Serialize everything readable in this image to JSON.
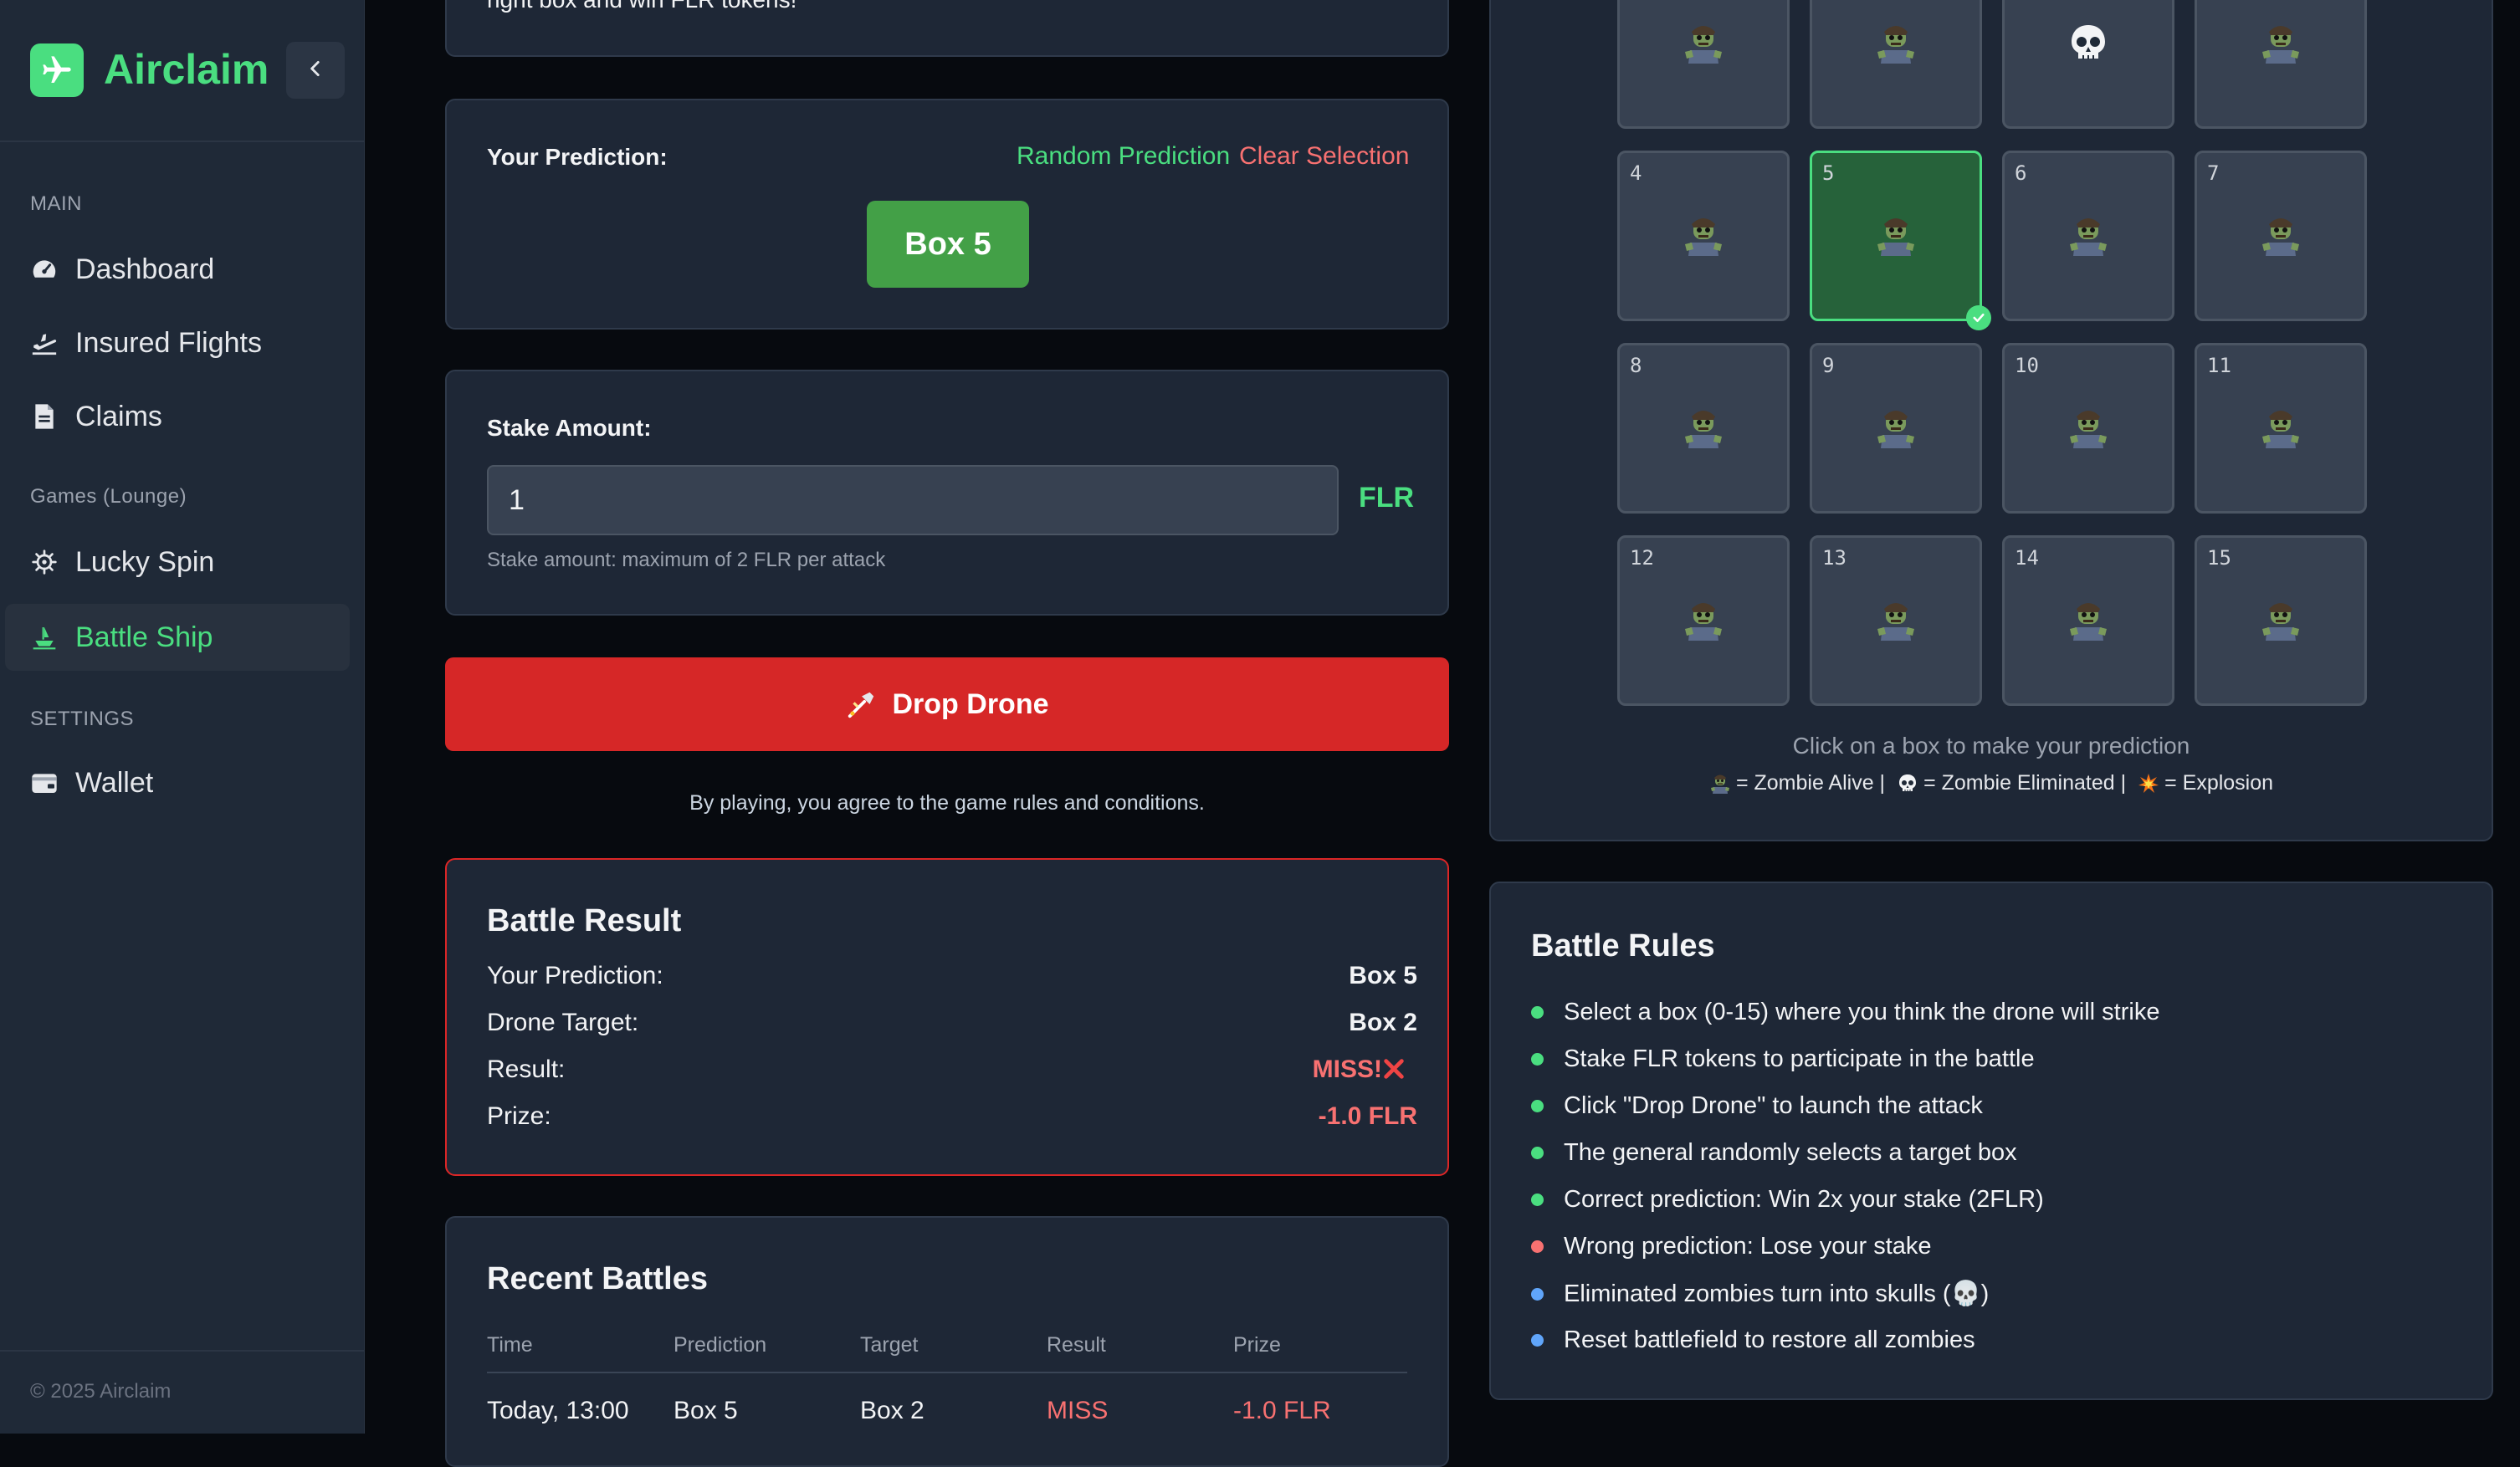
{
  "brand": {
    "name": "Airclaim"
  },
  "sidebar": {
    "sections": [
      {
        "title": "MAIN"
      },
      {
        "title": "Games (Lounge)"
      },
      {
        "title": "SETTINGS"
      }
    ],
    "items": [
      {
        "label": "Dashboard",
        "icon": "gauge-icon"
      },
      {
        "label": "Insured Flights",
        "icon": "plane-departure-icon"
      },
      {
        "label": "Claims",
        "icon": "document-icon"
      },
      {
        "label": "Lucky Spin",
        "icon": "helm-wheel-icon"
      },
      {
        "label": "Battle Ship",
        "icon": "ship-icon",
        "active": true
      },
      {
        "label": "Wallet",
        "icon": "wallet-icon"
      }
    ],
    "footer": "© 2025 Airclaim"
  },
  "intro": {
    "text": "right box and win FLR tokens!"
  },
  "prediction": {
    "label": "Your Prediction:",
    "random_link": "Random Prediction",
    "clear_link": "Clear Selection",
    "selected": "Box 5"
  },
  "stake": {
    "label": "Stake Amount:",
    "value": "1",
    "currency": "FLR",
    "helper": "Stake amount: maximum of 2 FLR per attack"
  },
  "drop_button": {
    "icon": "drone-icon",
    "label": "Drop Drone"
  },
  "agreement": "By playing, you agree to the game rules and conditions.",
  "battle_result": {
    "title": "Battle Result",
    "rows": [
      {
        "label": "Your Prediction:",
        "value": "Box 5"
      },
      {
        "label": "Drone Target:",
        "value": "Box 2"
      },
      {
        "label": "Result:",
        "value": "MISS!"
      },
      {
        "label": "Prize:",
        "value": "-1.0 FLR"
      }
    ]
  },
  "recent_battles": {
    "title": "Recent Battles",
    "columns": [
      "Time",
      "Prediction",
      "Target",
      "Result",
      "Prize"
    ],
    "rows": [
      [
        "Today, 13:00",
        "Box 5",
        "Box 2",
        "MISS",
        "-1.0 FLR"
      ]
    ]
  },
  "grid": {
    "cells": [
      {
        "num": "",
        "state": "alive"
      },
      {
        "num": "",
        "state": "alive"
      },
      {
        "num": "",
        "state": "eliminated"
      },
      {
        "num": "",
        "state": "alive"
      },
      {
        "num": "4",
        "state": "alive"
      },
      {
        "num": "5",
        "state": "alive",
        "selected": true
      },
      {
        "num": "6",
        "state": "alive"
      },
      {
        "num": "7",
        "state": "alive"
      },
      {
        "num": "8",
        "state": "alive"
      },
      {
        "num": "9",
        "state": "alive"
      },
      {
        "num": "10",
        "state": "alive"
      },
      {
        "num": "11",
        "state": "alive"
      },
      {
        "num": "12",
        "state": "alive"
      },
      {
        "num": "13",
        "state": "alive"
      },
      {
        "num": "14",
        "state": "alive"
      },
      {
        "num": "15",
        "state": "alive"
      }
    ],
    "hint": "Click on a box to make your prediction",
    "legend": {
      "alive": "= Zombie Alive |",
      "eliminated": "= Zombie Eliminated |",
      "explosion": "= Explosion"
    }
  },
  "rules": {
    "title": "Battle Rules",
    "items": [
      {
        "text": "Select a box (0-15) where you think the drone will strike",
        "color": "#4ade80"
      },
      {
        "text": "Stake FLR tokens to participate in the battle",
        "color": "#4ade80"
      },
      {
        "text": "Click \"Drop Drone\" to launch the attack",
        "color": "#4ade80"
      },
      {
        "text": "The general randomly selects a target box",
        "color": "#4ade80"
      },
      {
        "text": "Correct prediction: Win 2x your stake (2FLR)",
        "color": "#4ade80"
      },
      {
        "text": "Wrong prediction: Lose your stake",
        "color": "#f87171"
      },
      {
        "text": "Eliminated zombies turn into skulls (💀)",
        "color": "#60a5fa"
      },
      {
        "text": "Reset battlefield to restore all zombies",
        "color": "#60a5fa"
      }
    ]
  },
  "colors": {
    "accent": "#4ade80",
    "danger": "#d62727",
    "info": "#60a5fa"
  }
}
